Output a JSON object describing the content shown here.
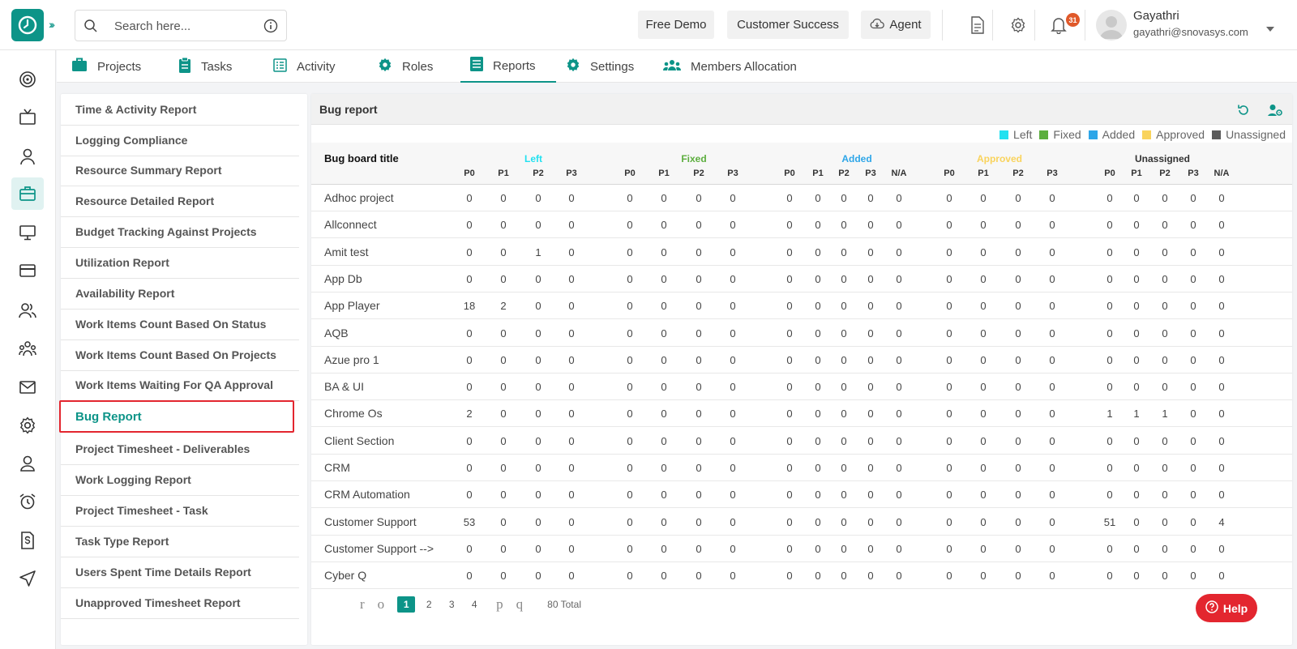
{
  "search": {
    "placeholder": "Search here..."
  },
  "topbar": {
    "free_demo": "Free Demo",
    "customer_success": "Customer Success",
    "agent": "Agent",
    "notification_count": "31",
    "user_name": "Gayathri",
    "user_email": "gayathri@snovasys.com"
  },
  "tabs": [
    {
      "label": "Projects",
      "icon": "briefcase-icon"
    },
    {
      "label": "Tasks",
      "icon": "clipboard-icon"
    },
    {
      "label": "Activity",
      "icon": "list-icon"
    },
    {
      "label": "Roles",
      "icon": "gear-icon"
    },
    {
      "label": "Reports",
      "icon": "report-icon"
    },
    {
      "label": "Settings",
      "icon": "gear-icon"
    },
    {
      "label": "Members Allocation",
      "icon": "members-icon"
    }
  ],
  "reports": {
    "items": [
      "Time & Activity Report",
      "Logging Compliance",
      "Resource Summary Report",
      "Resource Detailed Report",
      "Budget Tracking Against Projects",
      "Utilization Report",
      "Availability Report",
      "Work Items Count Based On Status",
      "Work Items Count Based On Projects",
      "Work Items Waiting For QA Approval",
      "Bug Report",
      "Project Timesheet - Deliverables",
      "Work Logging Report",
      "Project Timesheet - Task",
      "Task Type Report",
      "Users Spent Time Details Report",
      "Unapproved Timesheet Report"
    ],
    "active": "Bug Report"
  },
  "panel": {
    "title": "Bug report",
    "legend": [
      {
        "label": "Left",
        "color": "#22e1f0"
      },
      {
        "label": "Fixed",
        "color": "#5cae3e"
      },
      {
        "label": "Added",
        "color": "#2ea6e8"
      },
      {
        "label": "Approved",
        "color": "#f9d35c"
      },
      {
        "label": "Unassigned",
        "color": "#5b5b5b"
      }
    ]
  },
  "table": {
    "title_header": "Bug board title",
    "groups": [
      {
        "label": "Left",
        "color": "#22e1f0",
        "cols": [
          "P0",
          "P1",
          "P2",
          "P3"
        ]
      },
      {
        "label": "Fixed",
        "color": "#5cae3e",
        "cols": [
          "P0",
          "P1",
          "P2",
          "P3"
        ]
      },
      {
        "label": "Added",
        "color": "#2ea6e8",
        "cols": [
          "P0",
          "P1",
          "P2",
          "P3",
          "N/A"
        ]
      },
      {
        "label": "Approved",
        "color": "#f9d35c",
        "cols": [
          "P0",
          "P1",
          "P2",
          "P3"
        ]
      },
      {
        "label": "Unassigned",
        "color": "#333333",
        "cols": [
          "P0",
          "P1",
          "P2",
          "P3",
          "N/A"
        ]
      }
    ],
    "rows": [
      {
        "name": "Adhoc project",
        "values": [
          "0",
          "0",
          "0",
          "0",
          "0",
          "0",
          "0",
          "0",
          "0",
          "0",
          "0",
          "0",
          "0",
          "0",
          "0",
          "0",
          "0",
          "0",
          "0",
          "0",
          "0",
          "0"
        ]
      },
      {
        "name": "Allconnect",
        "values": [
          "0",
          "0",
          "0",
          "0",
          "0",
          "0",
          "0",
          "0",
          "0",
          "0",
          "0",
          "0",
          "0",
          "0",
          "0",
          "0",
          "0",
          "0",
          "0",
          "0",
          "0",
          "0"
        ]
      },
      {
        "name": "Amit test",
        "values": [
          "0",
          "0",
          "1",
          "0",
          "0",
          "0",
          "0",
          "0",
          "0",
          "0",
          "0",
          "0",
          "0",
          "0",
          "0",
          "0",
          "0",
          "0",
          "0",
          "0",
          "0",
          "0"
        ]
      },
      {
        "name": "App Db",
        "values": [
          "0",
          "0",
          "0",
          "0",
          "0",
          "0",
          "0",
          "0",
          "0",
          "0",
          "0",
          "0",
          "0",
          "0",
          "0",
          "0",
          "0",
          "0",
          "0",
          "0",
          "0",
          "0"
        ]
      },
      {
        "name": "App Player",
        "values": [
          "18",
          "2",
          "0",
          "0",
          "0",
          "0",
          "0",
          "0",
          "0",
          "0",
          "0",
          "0",
          "0",
          "0",
          "0",
          "0",
          "0",
          "0",
          "0",
          "0",
          "0",
          "0"
        ]
      },
      {
        "name": "AQB",
        "values": [
          "0",
          "0",
          "0",
          "0",
          "0",
          "0",
          "0",
          "0",
          "0",
          "0",
          "0",
          "0",
          "0",
          "0",
          "0",
          "0",
          "0",
          "0",
          "0",
          "0",
          "0",
          "0"
        ]
      },
      {
        "name": "Azue pro 1",
        "values": [
          "0",
          "0",
          "0",
          "0",
          "0",
          "0",
          "0",
          "0",
          "0",
          "0",
          "0",
          "0",
          "0",
          "0",
          "0",
          "0",
          "0",
          "0",
          "0",
          "0",
          "0",
          "0"
        ]
      },
      {
        "name": "BA & UI",
        "values": [
          "0",
          "0",
          "0",
          "0",
          "0",
          "0",
          "0",
          "0",
          "0",
          "0",
          "0",
          "0",
          "0",
          "0",
          "0",
          "0",
          "0",
          "0",
          "0",
          "0",
          "0",
          "0"
        ]
      },
      {
        "name": "Chrome Os",
        "values": [
          "2",
          "0",
          "0",
          "0",
          "0",
          "0",
          "0",
          "0",
          "0",
          "0",
          "0",
          "0",
          "0",
          "0",
          "0",
          "0",
          "0",
          "1",
          "1",
          "1",
          "0",
          "0"
        ]
      },
      {
        "name": "Client Section",
        "values": [
          "0",
          "0",
          "0",
          "0",
          "0",
          "0",
          "0",
          "0",
          "0",
          "0",
          "0",
          "0",
          "0",
          "0",
          "0",
          "0",
          "0",
          "0",
          "0",
          "0",
          "0",
          "0"
        ]
      },
      {
        "name": "CRM",
        "values": [
          "0",
          "0",
          "0",
          "0",
          "0",
          "0",
          "0",
          "0",
          "0",
          "0",
          "0",
          "0",
          "0",
          "0",
          "0",
          "0",
          "0",
          "0",
          "0",
          "0",
          "0",
          "0"
        ]
      },
      {
        "name": "CRM Automation",
        "values": [
          "0",
          "0",
          "0",
          "0",
          "0",
          "0",
          "0",
          "0",
          "0",
          "0",
          "0",
          "0",
          "0",
          "0",
          "0",
          "0",
          "0",
          "0",
          "0",
          "0",
          "0",
          "0"
        ]
      },
      {
        "name": "Customer Support",
        "values": [
          "53",
          "0",
          "0",
          "0",
          "0",
          "0",
          "0",
          "0",
          "0",
          "0",
          "0",
          "0",
          "0",
          "0",
          "0",
          "0",
          "0",
          "51",
          "0",
          "0",
          "0",
          "4"
        ]
      },
      {
        "name": "Customer Support -->",
        "values": [
          "0",
          "0",
          "0",
          "0",
          "0",
          "0",
          "0",
          "0",
          "0",
          "0",
          "0",
          "0",
          "0",
          "0",
          "0",
          "0",
          "0",
          "0",
          "0",
          "0",
          "0",
          "0"
        ]
      },
      {
        "name": "Cyber Q",
        "values": [
          "0",
          "0",
          "0",
          "0",
          "0",
          "0",
          "0",
          "0",
          "0",
          "0",
          "0",
          "0",
          "0",
          "0",
          "0",
          "0",
          "0",
          "0",
          "0",
          "0",
          "0",
          "0"
        ]
      }
    ]
  },
  "pagination": {
    "first": "r",
    "prev": "o",
    "pages": [
      "1",
      "2",
      "3",
      "4"
    ],
    "current": "1",
    "next": "p",
    "last": "q",
    "total": "80 Total"
  },
  "help": {
    "label": "Help"
  }
}
